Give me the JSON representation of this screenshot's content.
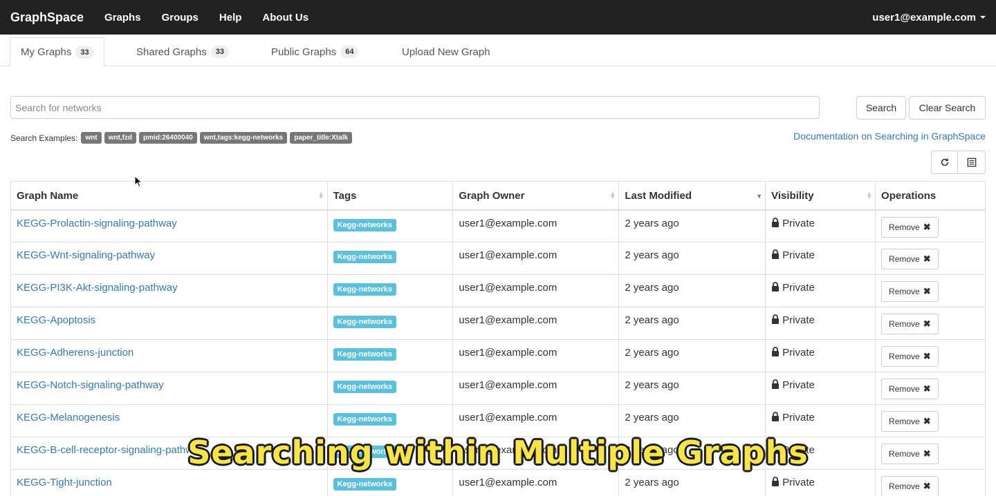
{
  "navbar": {
    "brand": "GraphSpace",
    "links": [
      "Graphs",
      "Groups",
      "Help",
      "About Us"
    ],
    "user": "user1@example.com"
  },
  "tabs": [
    {
      "label": "My Graphs",
      "count": "33"
    },
    {
      "label": "Shared Graphs",
      "count": "33"
    },
    {
      "label": "Public Graphs",
      "count": "64"
    },
    {
      "label": "Upload New Graph",
      "count": ""
    }
  ],
  "search": {
    "placeholder": "Search for networks",
    "value": "",
    "search_label": "Search",
    "clear_label": "Clear Search",
    "examples_label": "Search Examples:",
    "examples": [
      "wnt",
      "wnt,fzd",
      "pmid:26400040",
      "wnt,tags:kegg-networks",
      "paper_title:Xtalk"
    ],
    "doc_link": "Documentation on Searching in GraphSpace"
  },
  "toolbar": {
    "refresh_icon": "refresh-icon",
    "columns_icon": "list-columns-icon"
  },
  "table": {
    "columns": [
      "Graph Name",
      "Tags",
      "Graph Owner",
      "Last Modified",
      "Visibility",
      "Operations"
    ],
    "sort_column": "Last Modified",
    "sort_direction": "desc",
    "rows": [
      {
        "name": "KEGG-Prolactin-signaling-pathway",
        "tag": "Kegg-networks",
        "owner": "user1@example.com",
        "modified": "2 years ago",
        "visibility": "Private",
        "op": "Remove"
      },
      {
        "name": "KEGG-Wnt-signaling-pathway",
        "tag": "Kegg-networks",
        "owner": "user1@example.com",
        "modified": "2 years ago",
        "visibility": "Private",
        "op": "Remove"
      },
      {
        "name": "KEGG-PI3K-Akt-signaling-pathway",
        "tag": "Kegg-networks",
        "owner": "user1@example.com",
        "modified": "2 years ago",
        "visibility": "Private",
        "op": "Remove"
      },
      {
        "name": "KEGG-Apoptosis",
        "tag": "Kegg-networks",
        "owner": "user1@example.com",
        "modified": "2 years ago",
        "visibility": "Private",
        "op": "Remove"
      },
      {
        "name": "KEGG-Adherens-junction",
        "tag": "Kegg-networks",
        "owner": "user1@example.com",
        "modified": "2 years ago",
        "visibility": "Private",
        "op": "Remove"
      },
      {
        "name": "KEGG-Notch-signaling-pathway",
        "tag": "Kegg-networks",
        "owner": "user1@example.com",
        "modified": "2 years ago",
        "visibility": "Private",
        "op": "Remove"
      },
      {
        "name": "KEGG-Melanogenesis",
        "tag": "Kegg-networks",
        "owner": "user1@example.com",
        "modified": "2 years ago",
        "visibility": "Private",
        "op": "Remove"
      },
      {
        "name": "KEGG-B-cell-receptor-signaling-pathway",
        "tag": "Kegg-networks",
        "owner": "user1@example.com",
        "modified": "2 years ago",
        "visibility": "Private",
        "op": "Remove"
      },
      {
        "name": "KEGG-Tight-junction",
        "tag": "Kegg-networks",
        "owner": "user1@example.com",
        "modified": "2 years ago",
        "visibility": "Private",
        "op": "Remove"
      }
    ]
  },
  "caption": "Searching within Multiple Graphs",
  "colors": {
    "navbar_bg": "#222222",
    "link": "#337ab7",
    "tag_bg": "#5bc0de",
    "example_bg": "#777777",
    "caption": "#f7e44a"
  }
}
